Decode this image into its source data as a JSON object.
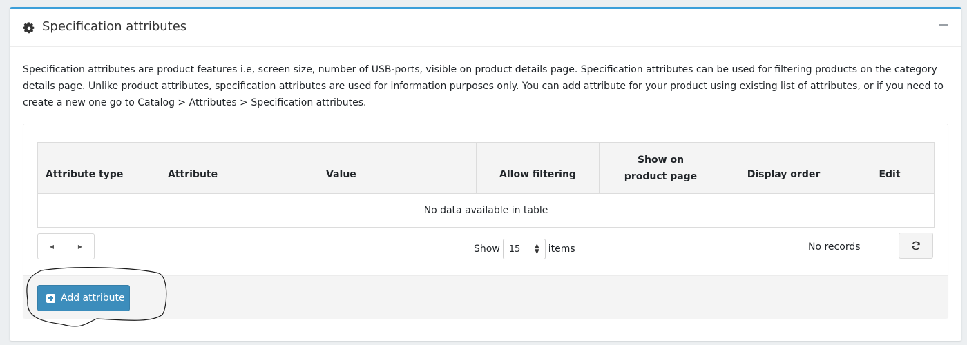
{
  "panel": {
    "title": "Specification attributes",
    "title_icon": "gear-icon",
    "collapse_icon": "minus-icon"
  },
  "description": "Specification attributes are product features i.e, screen size, number of USB-ports, visible on product details page. Specification attributes can be used for filtering products on the category details page. Unlike product attributes, specification attributes are used for information purposes only. You can add attribute for your product using existing list of attributes, or if you need to create a new one go to Catalog > Attributes > Specification attributes.",
  "table": {
    "columns": [
      "Attribute type",
      "Attribute",
      "Value",
      "Allow filtering",
      "Show on product page",
      "Display order",
      "Edit"
    ],
    "empty_message": "No data available in table"
  },
  "pagination": {
    "show_label": "Show",
    "page_size": "15",
    "items_label": "items",
    "records_text": "No records",
    "prev_icon": "caret-left-icon",
    "next_icon": "caret-right-icon",
    "refresh_icon": "refresh-icon"
  },
  "footer": {
    "add_button_label": "Add attribute",
    "add_button_icon": "plus-square-icon"
  },
  "colors": {
    "accent_top": "#3c9fd9",
    "primary_button": "#3c8dbc"
  }
}
